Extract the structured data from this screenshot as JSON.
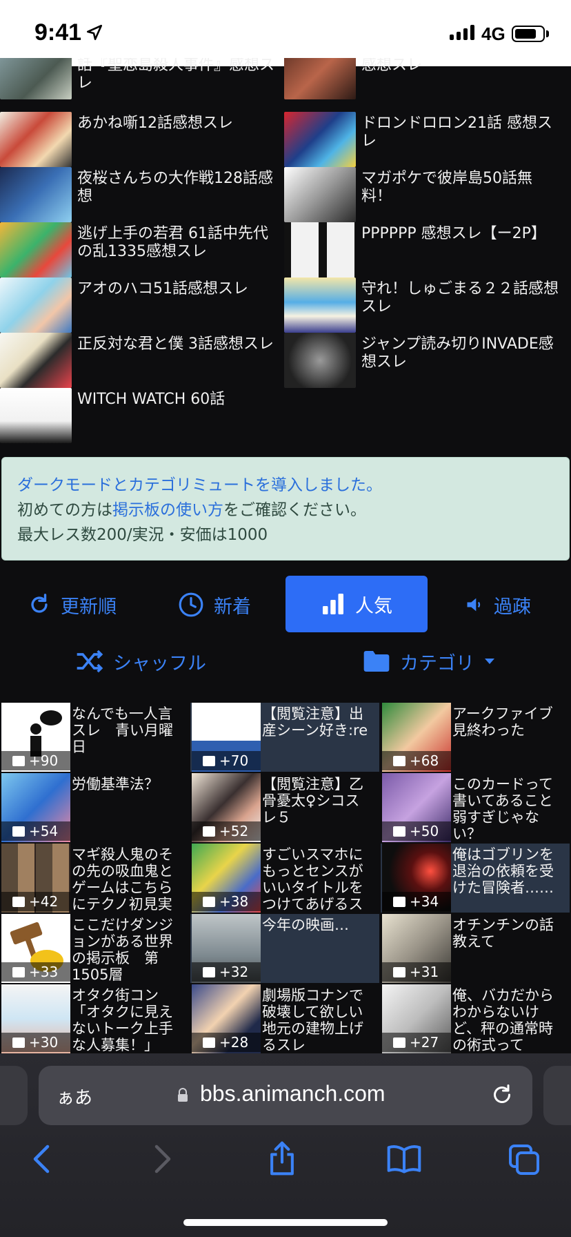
{
  "status_bar": {
    "time": "9:41",
    "network": "4G",
    "battery_level": 0.8
  },
  "top_threads": [
    {
      "title": "話『聖恋島殺人事件』感想スレ"
    },
    {
      "title": "感想スレ"
    },
    {
      "title": "あかね噺12話感想スレ"
    },
    {
      "title": "ドロンドロロン21話 感想スレ"
    },
    {
      "title": "夜桜さんちの大作戦128話感想"
    },
    {
      "title": "マガポケで彼岸島50話無料！"
    },
    {
      "title": "逃げ上手の若君 61話中先代の乱1335感想スレ"
    },
    {
      "title": "PPPPPP 感想スレ【ー2P】"
    },
    {
      "title": "アオのハコ51話感想スレ"
    },
    {
      "title": "守れ！しゅごまる２２話感想スレ"
    },
    {
      "title": "正反対な君と僕 3話感想スレ"
    },
    {
      "title": "ジャンプ読み切りINVADE感想スレ"
    },
    {
      "title": "WITCH WATCH 60話"
    }
  ],
  "notice": {
    "line1_link": "ダークモードとカテゴリミュートを導入しました。",
    "line2_prefix": "初めての方は",
    "line2_link": "掲示板の使い方",
    "line2_suffix": "をご確認ください。",
    "line3": "最大レス数200/実況・安価は1000"
  },
  "sort_tabs": {
    "updated": "更新順",
    "new": "新着",
    "popular": "人気",
    "old": "過疎",
    "shuffle": "シャッフル",
    "category": "カテゴリ",
    "active": "popular"
  },
  "grid_threads": [
    {
      "title": "なんでも一人言スレ　青い月曜日",
      "count": "+90"
    },
    {
      "title": "【閲覧注意】出産シーン好き:re",
      "count": "+70"
    },
    {
      "title": "アークファイブ見終わった",
      "count": "+68"
    },
    {
      "title": "労働基準法？",
      "count": "+54"
    },
    {
      "title": "【閲覧注意】乙骨憂太♀シコスレ５",
      "count": "+52"
    },
    {
      "title": "このカードって書いてあること弱すぎじゃない？",
      "count": "+50"
    },
    {
      "title": "マギ殺人鬼のその先の吸血鬼とゲームはこちらにテクノ初見実",
      "count": "+42"
    },
    {
      "title": "すごいスマホにもっとセンスがいいタイトルをつけてあげるス",
      "count": "+38"
    },
    {
      "title": "俺はゴブリンを退治の依頼を受けた冒険者……",
      "count": "+34"
    },
    {
      "title": "ここだけダンジョンがある世界の掲示板　第1505層",
      "count": "+33"
    },
    {
      "title": "今年の映画…",
      "count": "+32"
    },
    {
      "title": "オチンチンの話教えて",
      "count": "+31"
    },
    {
      "title": "オタク街コン「オタクに見えないトーク上手な人募集！」",
      "count": "+30"
    },
    {
      "title": "劇場版コナンで破壊して欲しい地元の建物上げるスレ",
      "count": "+28"
    },
    {
      "title": "俺、バカだからわからないけど、秤の通常時の術式って",
      "count": "+27"
    }
  ],
  "browser": {
    "aa_label": "ぁあ",
    "host": "bbs.animanch.com"
  },
  "colors": {
    "accent": "#2d6df6",
    "notice_bg": "#d3e8e0",
    "link": "#2a6fdb"
  }
}
